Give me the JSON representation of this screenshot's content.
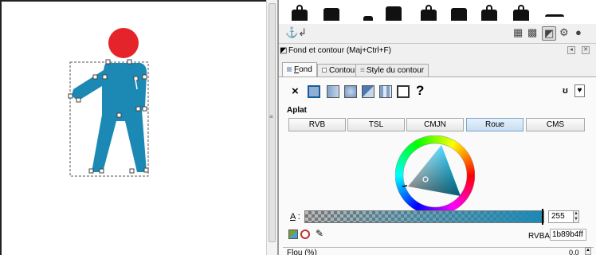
{
  "canvas": {
    "figure_color": "#1b89b4",
    "head_color": "#e5232a"
  },
  "panel": {
    "dialog_title": "Fond et contour (Maj+Ctrl+F)",
    "tabs": [
      {
        "label": "Fond",
        "mnemonic": "F",
        "rest": "ond",
        "active": true
      },
      {
        "label": "Contour",
        "active": false
      },
      {
        "label": "Style du contour",
        "active": false
      }
    ],
    "paint_type_label": "Aplat",
    "unknown_paint": "?",
    "no_paint": "×",
    "modes": [
      {
        "label": "RVB",
        "active": false
      },
      {
        "label": "TSL",
        "active": false
      },
      {
        "label": "CMJN",
        "active": false
      },
      {
        "label": "Roue",
        "active": true
      },
      {
        "label": "CMS",
        "active": false
      }
    ],
    "alpha_label": "A",
    "alpha_colon": " :",
    "alpha_value": "255",
    "rgba_label": "RVBA :",
    "rgba_value": "1b89b4ff",
    "flou_label": "Flou (%)",
    "flou_value": "0.0",
    "selected_color": "#1b89b4"
  }
}
